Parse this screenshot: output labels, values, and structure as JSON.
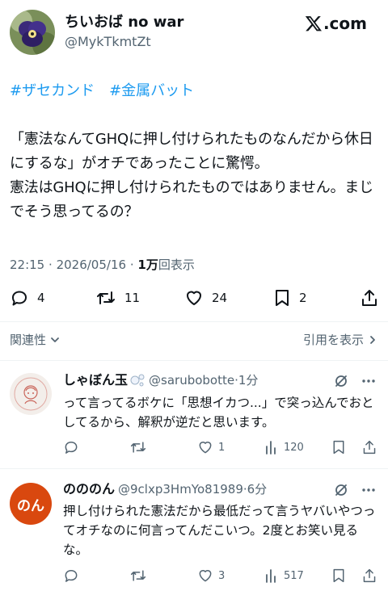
{
  "header": {
    "display_name": "ちいおば no war",
    "handle": "@MykTkmtZt",
    "brand_domain": ".com"
  },
  "post": {
    "hashtags": [
      "#ザセカンド",
      "#金属バット"
    ],
    "text": "「憲法なんてGHQに押し付けられたものなんだから休日にするな」がオチであったことに驚愕。\n憲法はGHQに押し付けられたものではありません。まじでそう思ってるの？",
    "time": "22:15",
    "dot": "·",
    "date": "2026/05/16",
    "views_count": "1万",
    "views_label": "回表示",
    "replies": "4",
    "reposts": "11",
    "likes": "24",
    "bookmarks": "2"
  },
  "links": {
    "related": "関連性",
    "quotes": "引用を表示"
  },
  "replies": [
    {
      "name": "しゃぼん玉",
      "handle": "@sarubobotte",
      "time": "·1分",
      "text": "って言ってるボケに「思想イカつ...」で突っ込んでおとしてるから、解釈が逆だと思います。",
      "replies": "",
      "reposts": "",
      "likes": "1",
      "views": "120"
    },
    {
      "name": "のののん",
      "handle": "@9clxp3HmYo81989",
      "time": "·6分",
      "avatar_text": "のん",
      "text": "押し付けられた憲法だから最低だって言うヤバいやつってオチなのに何言ってんだこいつ。2度とお笑い見るな。",
      "replies": "",
      "reposts": "",
      "likes": "3",
      "views": "517"
    }
  ],
  "colors": {
    "accent": "#1d9bf0",
    "secondary_text": "#536471",
    "primary_text": "#0f1419",
    "separator": "#eff3f4",
    "avatar_orange": "#d9480f"
  }
}
